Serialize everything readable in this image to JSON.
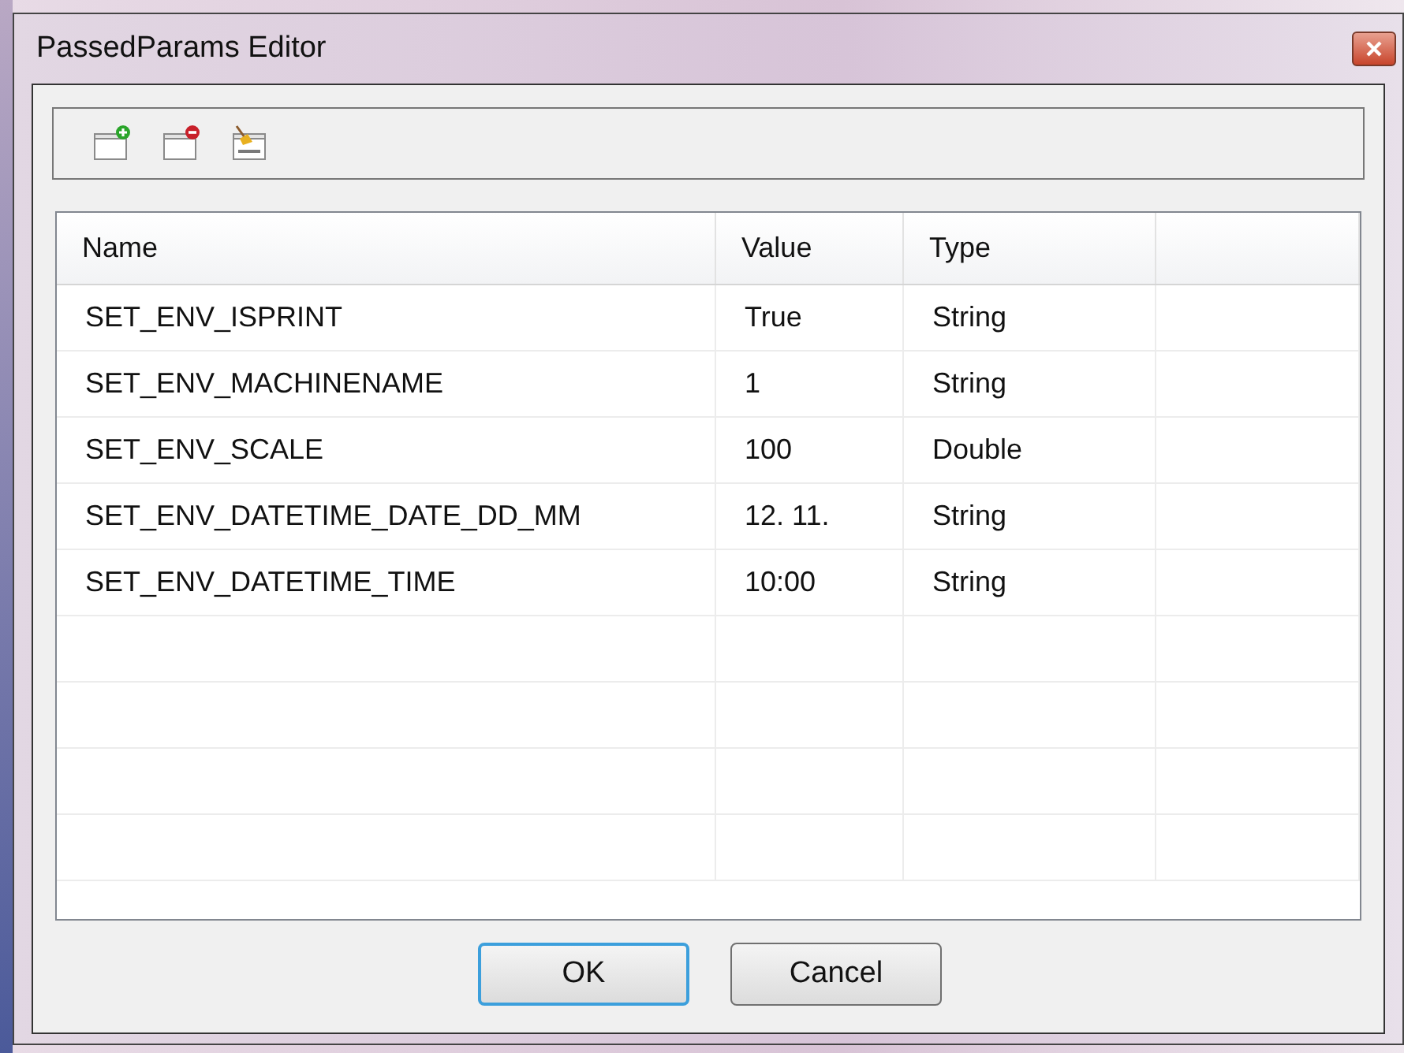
{
  "window": {
    "title": "PassedParams Editor"
  },
  "toolbar": [
    {
      "kind": "add"
    },
    {
      "kind": "remove"
    },
    {
      "kind": "null"
    }
  ],
  "table": {
    "columns": [
      "Name",
      "Value",
      "Type"
    ],
    "rows": [
      [
        "SET_ENV_ISPRINT",
        "True",
        "String"
      ],
      [
        "SET_ENV_MACHINENAME",
        "1",
        "String"
      ],
      [
        "SET_ENV_SCALE",
        "100",
        "Double"
      ],
      [
        "SET_ENV_DATETIME_DATE_DD_MM",
        "12. 11.",
        "String"
      ],
      [
        "SET_ENV_DATETIME_TIME",
        "10:00",
        "String"
      ]
    ]
  },
  "buttons": [
    {
      "label": "OK",
      "selected": true
    },
    {
      "label": "Cancel",
      "selected": false
    }
  ]
}
